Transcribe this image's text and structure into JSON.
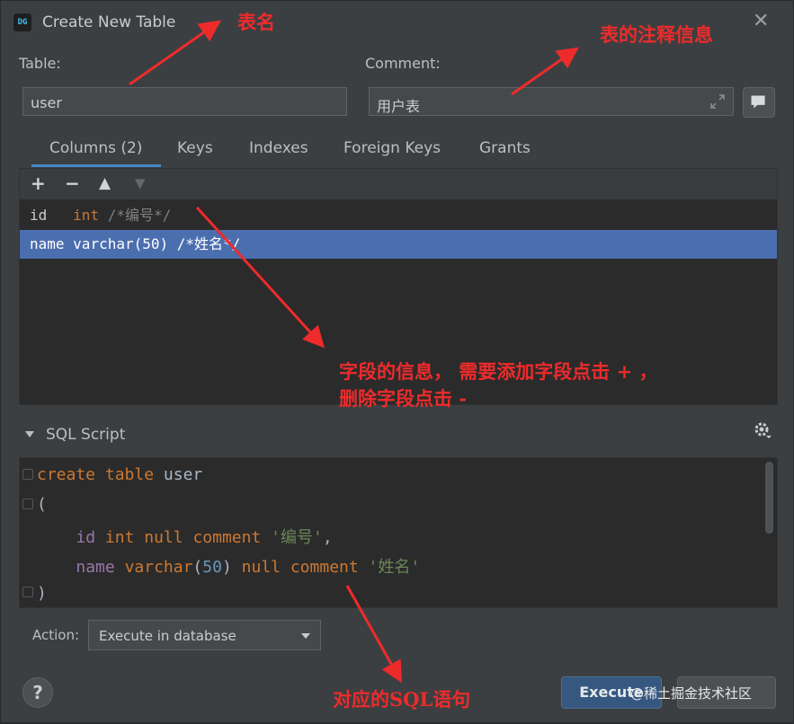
{
  "window": {
    "app_icon": "DG",
    "title": "Create New Table"
  },
  "form": {
    "table_label": "Table:",
    "table_value": "user",
    "comment_label": "Comment:",
    "comment_value": "用户表"
  },
  "tabs": [
    "Columns (2)",
    "Keys",
    "Indexes",
    "Foreign Keys",
    "Grants"
  ],
  "columns_toolbar": [
    "+",
    "−",
    "▲",
    "▼"
  ],
  "columns": [
    {
      "name": "id",
      "type": "int",
      "comment": "/*编号*/"
    },
    {
      "name": "name",
      "type": "varchar(50)",
      "comment": "/*姓名*/"
    }
  ],
  "sql_script": {
    "header": "SQL Script",
    "lines": [
      "create table user",
      "(",
      "    id int null comment '编号',",
      "    name varchar(50) null comment '姓名'",
      ")"
    ]
  },
  "action": {
    "label": "Action:",
    "selected": "Execute in database"
  },
  "buttons": {
    "help": "?",
    "execute": "Execute"
  },
  "watermark": "@稀土掘金技术社区",
  "annotations": {
    "table_name": "表名",
    "table_comment": "表的注释信息",
    "fields_line1": "字段的信息， 需要添加字段点击 + ，",
    "fields_line2": "删除字段点击 -",
    "sql": "对应的SQL语句"
  },
  "colors": {
    "annotation": "#ee2b2b",
    "selection": "#4b6eaf",
    "accent": "#4a88c7",
    "keyword": "#cc7832"
  }
}
